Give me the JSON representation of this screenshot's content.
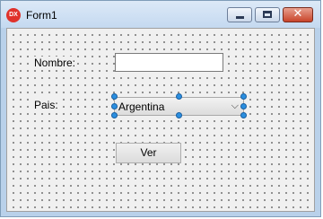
{
  "window": {
    "title": "Form1",
    "icon_text": "DX",
    "controls": {
      "minimize_icon": "minimize-icon",
      "maximize_icon": "maximize-icon",
      "close_icon": "close-icon",
      "close_glyph": "✕"
    }
  },
  "form": {
    "nombre_label": "Nombre:",
    "nombre_value": "",
    "pais_label": "Pais:",
    "pais_selected": "Argentina",
    "dropdown_glyph": "⌵",
    "ver_button": "Ver"
  },
  "colors": {
    "selection_handle": "#2b8fe0",
    "close_button": "#c8442a",
    "app_icon": "#e0322b"
  }
}
